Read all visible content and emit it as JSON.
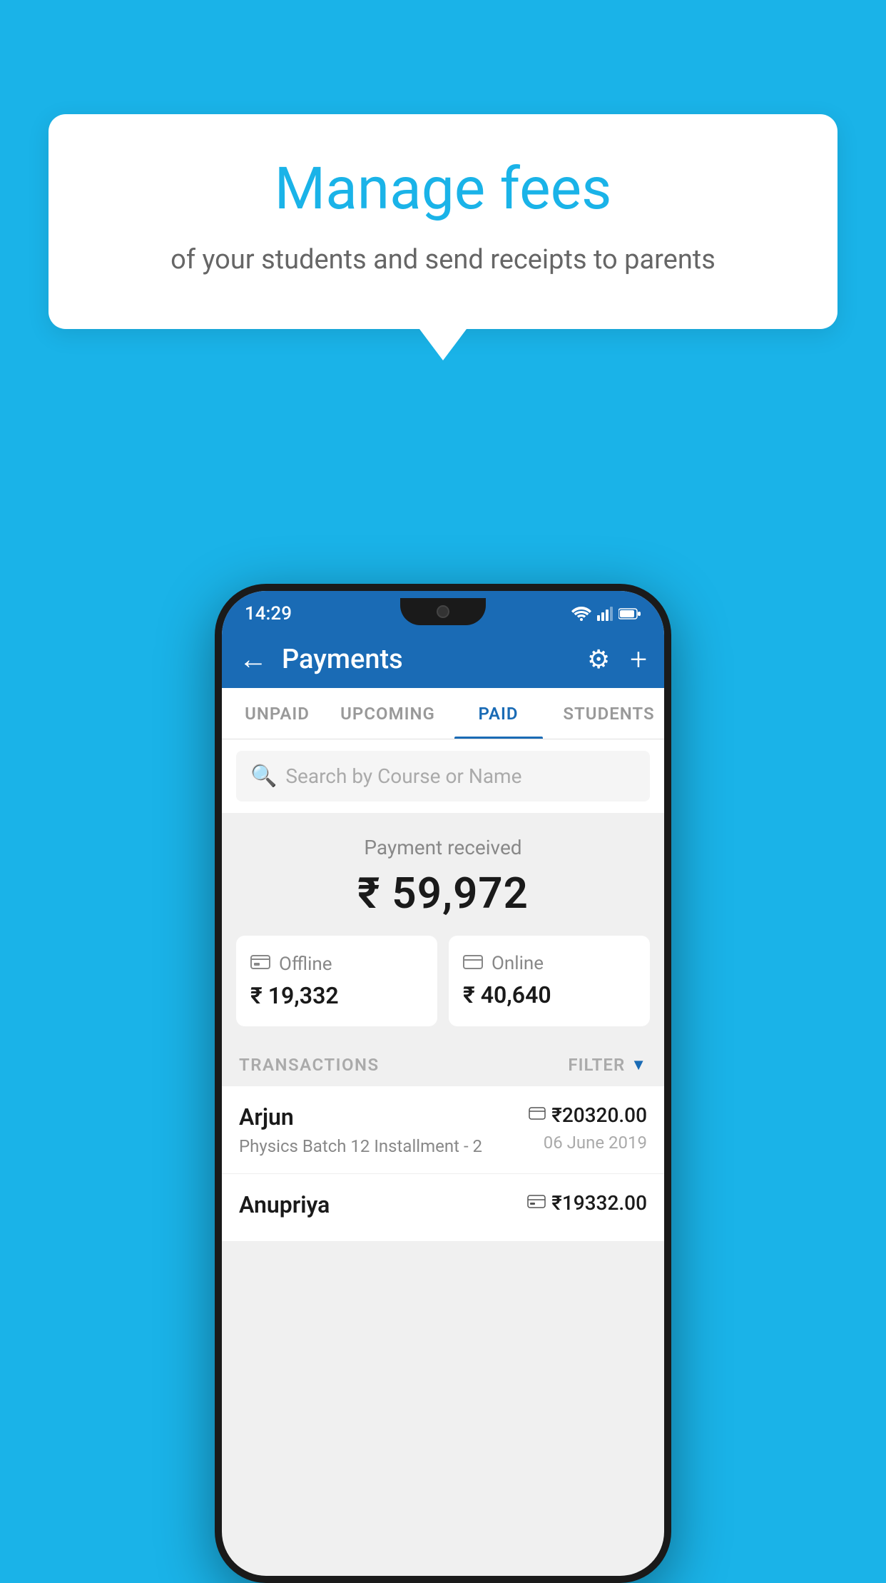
{
  "tooltip": {
    "title": "Manage fees",
    "subtitle": "of your students and send receipts to parents"
  },
  "statusBar": {
    "time": "14:29",
    "icons": [
      "wifi",
      "signal",
      "battery"
    ]
  },
  "header": {
    "title": "Payments",
    "backLabel": "←",
    "settingsLabel": "⚙",
    "addLabel": "+"
  },
  "tabs": [
    {
      "label": "UNPAID",
      "active": false
    },
    {
      "label": "UPCOMING",
      "active": false
    },
    {
      "label": "PAID",
      "active": true
    },
    {
      "label": "STUDENTS",
      "active": false
    }
  ],
  "search": {
    "placeholder": "Search by Course or Name"
  },
  "paymentReceived": {
    "label": "Payment received",
    "amount": "₹ 59,972"
  },
  "paymentCards": [
    {
      "type": "Offline",
      "amount": "₹ 19,332",
      "icon": "offline"
    },
    {
      "type": "Online",
      "amount": "₹ 40,640",
      "icon": "online"
    }
  ],
  "transactionsHeader": {
    "label": "TRANSACTIONS",
    "filterLabel": "FILTER"
  },
  "transactions": [
    {
      "name": "Arjun",
      "course": "Physics Batch 12 Installment - 2",
      "amount": "₹20320.00",
      "date": "06 June 2019",
      "type": "online"
    },
    {
      "name": "Anupriya",
      "course": "",
      "amount": "₹19332.00",
      "date": "",
      "type": "offline"
    }
  ],
  "colors": {
    "background": "#1ab3e8",
    "appHeaderBg": "#1a6bb5",
    "tabActiveLine": "#1a6bb5",
    "tabActiveText": "#1a6bb5",
    "filterIconColor": "#1a6bb5"
  }
}
